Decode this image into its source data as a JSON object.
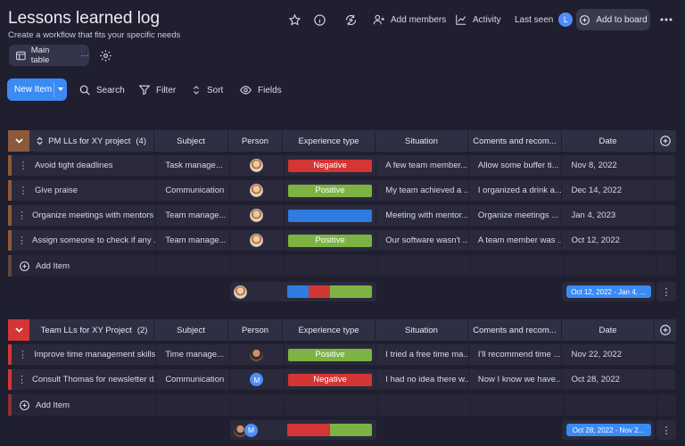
{
  "header": {
    "title": "Lessons learned log",
    "subtitle": "Create a workflow that fits your specific needs",
    "add_members": "Add members",
    "activity": "Activity",
    "last_seen": "Last seen",
    "last_seen_avatar": "L",
    "add_to_board": "Add to board"
  },
  "view": {
    "tab_label": "Main table",
    "tab_more": "···"
  },
  "toolbar": {
    "new_item": "New Item",
    "search": "Search",
    "filter": "Filter",
    "sort": "Sort",
    "fields": "Fields"
  },
  "colors": {
    "negative": "#d43535",
    "positive": "#7cb342",
    "neutral": "#2f7be0",
    "accent": "#3b8bf5",
    "group1": "#8b5a3c",
    "group2": "#d43535"
  },
  "columns": [
    "Subject",
    "Person",
    "Experience type",
    "Situation",
    "Coments and recom...",
    "Date"
  ],
  "add_item_label": "Add Item",
  "groups": [
    {
      "title": "PM LLs for XY project",
      "count": "(4)",
      "items": [
        {
          "name": "Avoid tight deadlines",
          "subject": "Task manage...",
          "exp": "Negative",
          "exp_color": "negative",
          "situation": "A few team member...",
          "comments": "Allow some buffer ti...",
          "date": "Nov 8, 2022"
        },
        {
          "name": "Give praise",
          "subject": "Communication",
          "exp": "Positive",
          "exp_color": "positive",
          "situation": "My team achieved a ...",
          "comments": "I organized a drink a...",
          "date": "Dec 14, 2022"
        },
        {
          "name": "Organize meetings with mentors ...",
          "subject": "Team manage...",
          "exp": "",
          "exp_color": "neutral",
          "situation": "Meeting with mentor...",
          "comments": "Organize meetings ...",
          "date": "Jan 4, 2023"
        },
        {
          "name": "Assign someone to check if any ...",
          "subject": "Team manage...",
          "exp": "Positive",
          "exp_color": "positive",
          "situation": "Our software wasn't ...",
          "comments": "A team member was ...",
          "date": "Oct 12, 2022"
        }
      ],
      "summary_bar": [
        0.25,
        0.25,
        0.5
      ],
      "summary_bar_colors": [
        "neutral",
        "negative",
        "positive"
      ],
      "date_range": "Oct 12, 2022 - Jan 4, ..."
    },
    {
      "title": "Team LLs for XY Project",
      "count": "(2)",
      "items": [
        {
          "name": "Improve time management skills",
          "subject": "Time manage...",
          "exp": "Positive",
          "exp_color": "positive",
          "situation": "I tried a free time ma...",
          "comments": "I'll recommend time ...",
          "date": "Nov 22, 2022",
          "person": "face-m"
        },
        {
          "name": "Consult Thomas for newsletter d...",
          "subject": "Communication",
          "exp": "Negative",
          "exp_color": "negative",
          "situation": "I had no idea there w...",
          "comments": "Now I know we have...",
          "date": "Oct 28, 2022",
          "person": "M"
        }
      ],
      "summary_bar": [
        0.5,
        0.5
      ],
      "summary_bar_colors": [
        "negative",
        "positive"
      ],
      "date_range": "Oct 28, 2022 - Nov 2..."
    }
  ]
}
